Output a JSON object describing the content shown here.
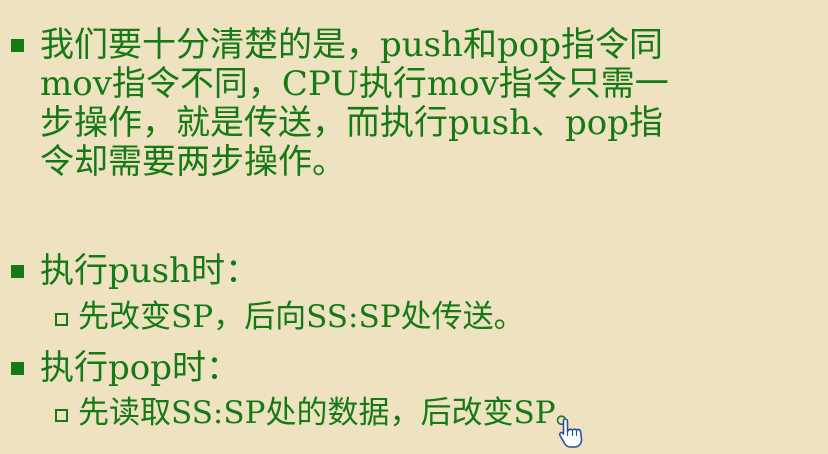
{
  "paragraph1": {
    "lines": [
      "我们要十分清楚的是，push和pop指令同",
      "mov指令不同，CPU执行mov指令只需一",
      "步操作，就是传送，而执行push、pop指",
      "令却需要两步操作。"
    ]
  },
  "push_section": {
    "heading": "执行push时：",
    "item": "先改变SP，后向SS:SP处传送。"
  },
  "pop_section": {
    "heading": "执行pop时：",
    "item": "先读取SS:SP处的数据，后改变SP。"
  },
  "colors": {
    "background": "#efe2c0",
    "text": "#157a15"
  },
  "cursor_icon": "hand-pointer-icon"
}
